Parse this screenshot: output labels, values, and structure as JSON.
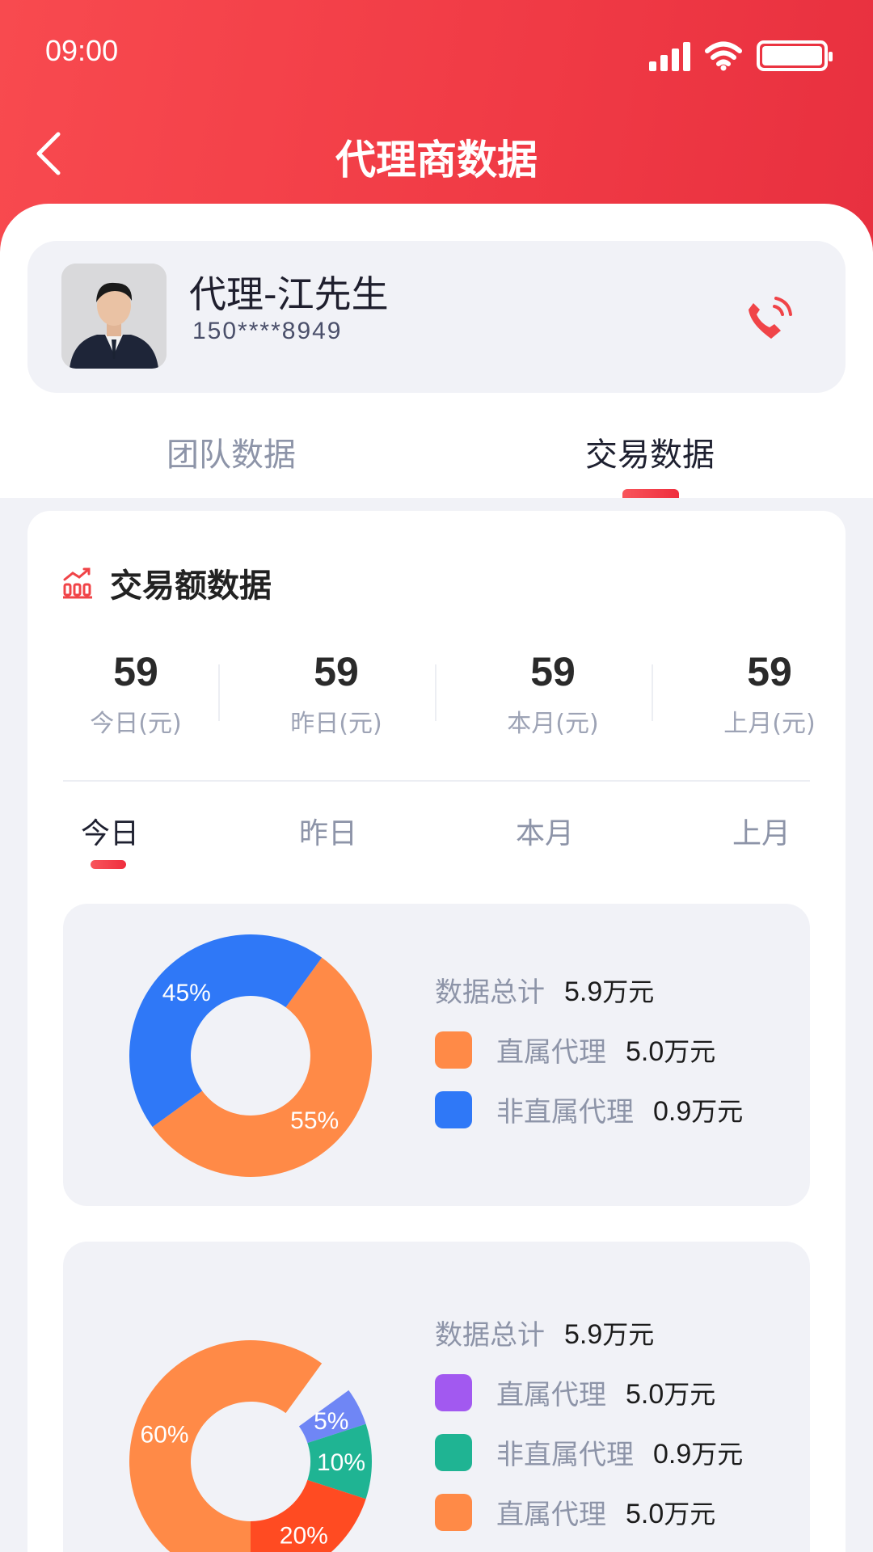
{
  "status": {
    "time": "09:00"
  },
  "nav": {
    "title": "代理商数据",
    "back_icon": "chevron-left-icon"
  },
  "profile": {
    "name": "代理-江先生",
    "phone": "150****8949",
    "call_icon": "phone-call-icon"
  },
  "main_tabs": [
    {
      "label": "团队数据",
      "active": false
    },
    {
      "label": "交易数据",
      "active": true
    }
  ],
  "card": {
    "title": "交易额数据",
    "icon": "bar-chart-icon",
    "stats": [
      {
        "value": "59",
        "label": "今日(元)"
      },
      {
        "value": "59",
        "label": "昨日(元)"
      },
      {
        "value": "59",
        "label": "本月(元)"
      },
      {
        "value": "59",
        "label": "上月(元)"
      }
    ],
    "period_tabs": [
      {
        "label": "今日",
        "active": true
      },
      {
        "label": "昨日",
        "active": false
      },
      {
        "label": "本月",
        "active": false
      },
      {
        "label": "上月",
        "active": false
      }
    ]
  },
  "chart_data": [
    {
      "type": "pie",
      "donut": true,
      "total_label": "数据总计",
      "total_value": "5.9",
      "total_unit": "万元",
      "slices": [
        {
          "name": "直属代理",
          "percent": 55,
          "value": "5.0",
          "unit": "万元",
          "color": "#ff8a47"
        },
        {
          "name": "非直属代理",
          "percent": 45,
          "value": "0.9",
          "unit": "万元",
          "color": "#2f78f7"
        }
      ]
    },
    {
      "type": "pie",
      "donut": true,
      "total_label": "数据总计",
      "total_value": "5.9",
      "total_unit": "万元",
      "slices": [
        {
          "name": "直属代理",
          "percent": 5,
          "value": "5.0",
          "unit": "万元",
          "color": "#a259f0",
          "slice_color": "#6f86f5"
        },
        {
          "name": "非直属代理",
          "percent": 10,
          "value": "0.9",
          "unit": "万元",
          "color": "#1fb493"
        },
        {
          "name": "",
          "percent": 20,
          "color": "#ff4b22"
        },
        {
          "name": "直属代理",
          "percent": 60,
          "value": "5.0",
          "unit": "万元",
          "color": "#ff8a47"
        }
      ]
    }
  ],
  "colors": {
    "brand": "#f03a45",
    "bg": "#f1f2f7"
  }
}
